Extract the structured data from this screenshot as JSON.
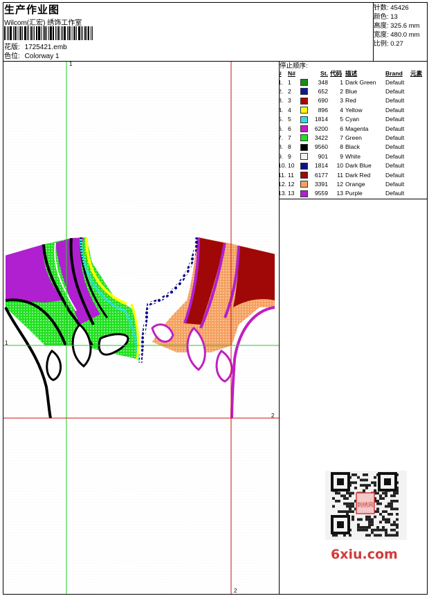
{
  "header": {
    "title": "生产作业图",
    "subtitle": "Wilcom(汇宏) 绣饰工作室",
    "design_label": "花版:",
    "design_value": "1725421.emb",
    "colorway_label": "色位:",
    "colorway_value": "Colorway 1"
  },
  "stats": {
    "stitches": "针数: 45426",
    "colors": "颜色: 13",
    "height": "高度: 325.6 mm",
    "width": "宽度: 480.0 mm",
    "scale": "比例: 0.27"
  },
  "stop_sequence": {
    "title": "停止顺序:",
    "headers": [
      "#",
      "N#",
      "St.",
      "代码",
      "描述",
      "Brand",
      "元素"
    ],
    "rows": [
      {
        "idx": "1.",
        "n": "1",
        "color": "#1a8a1a",
        "st": "348",
        "code": "1",
        "desc": "Dark Green",
        "brand": "Default"
      },
      {
        "idx": "2.",
        "n": "2",
        "color": "#0a1a9a",
        "st": "652",
        "code": "2",
        "desc": "Blue",
        "brand": "Default"
      },
      {
        "idx": "3.",
        "n": "3",
        "color": "#b00000",
        "st": "690",
        "code": "3",
        "desc": "Red",
        "brand": "Default"
      },
      {
        "idx": "4.",
        "n": "4",
        "color": "#ffff00",
        "st": "896",
        "code": "4",
        "desc": "Yellow",
        "brand": "Default"
      },
      {
        "idx": "5.",
        "n": "5",
        "color": "#30e0e0",
        "st": "1814",
        "code": "5",
        "desc": "Cyan",
        "brand": "Default"
      },
      {
        "idx": "6.",
        "n": "6",
        "color": "#c020c0",
        "st": "6200",
        "code": "6",
        "desc": "Magenta",
        "brand": "Default"
      },
      {
        "idx": "7.",
        "n": "7",
        "color": "#20e020",
        "st": "3422",
        "code": "7",
        "desc": "Green",
        "brand": "Default"
      },
      {
        "idx": "8.",
        "n": "8",
        "color": "#000000",
        "st": "9560",
        "code": "8",
        "desc": "Black",
        "brand": "Default"
      },
      {
        "idx": "9.",
        "n": "9",
        "color": "#f4f4f4",
        "st": "901",
        "code": "9",
        "desc": "White",
        "brand": "Default"
      },
      {
        "idx": "10.",
        "n": "10",
        "color": "#10108a",
        "st": "1814",
        "code": "10",
        "desc": "Dark Blue",
        "brand": "Default"
      },
      {
        "idx": "11.",
        "n": "11",
        "color": "#a00808",
        "st": "6177",
        "code": "11",
        "desc": "Dark Red",
        "brand": "Default"
      },
      {
        "idx": "12.",
        "n": "12",
        "color": "#f4a060",
        "st": "3391",
        "code": "12",
        "desc": "Orange",
        "brand": "Default"
      },
      {
        "idx": "13.",
        "n": "13",
        "color": "#b020d0",
        "st": "9559",
        "code": "13",
        "desc": "Purple",
        "brand": "Default"
      }
    ]
  },
  "guides": {
    "vertical_top": "1",
    "horizontal_left": "1",
    "horizontal_right": "2",
    "vertical_bottom": "2"
  },
  "watermark": {
    "site": "6xiu.com",
    "stamp": "刺绣网"
  },
  "colors": {
    "guide_green": "#22cc22",
    "guide_red": "#cc1111"
  }
}
